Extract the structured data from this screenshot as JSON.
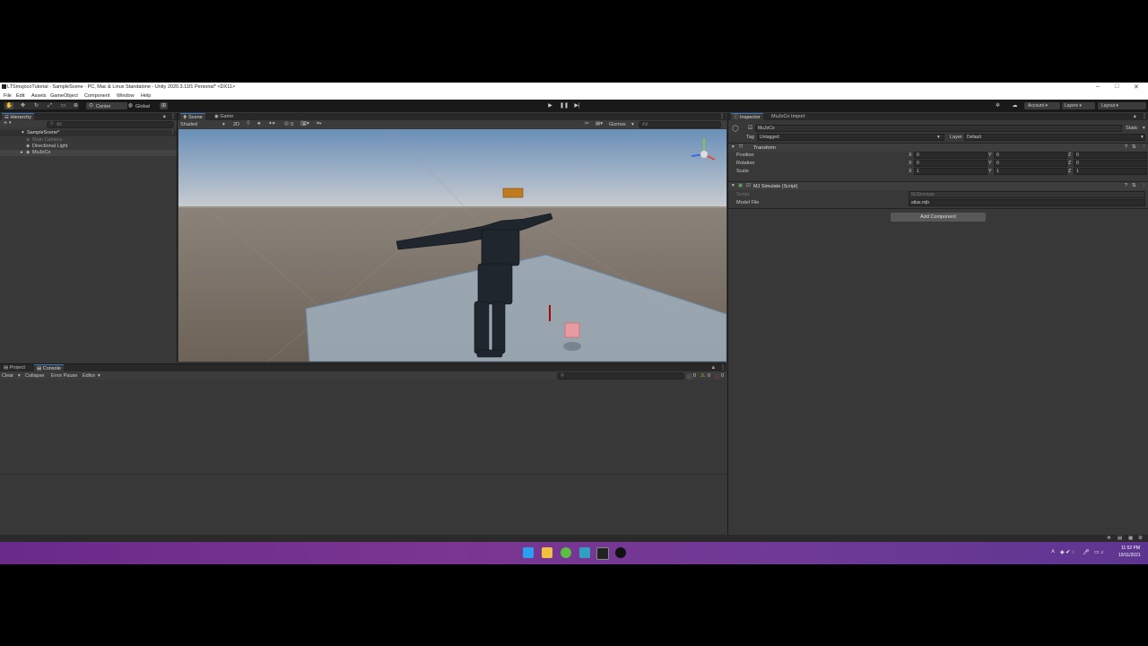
{
  "window": {
    "title": "LTSmujocoTutorial - SampleScene - PC, Mac & Linux Standalone - Unity 2020.3.11f1 Personal* <DX11>",
    "controls": {
      "minimize": "–",
      "maximize": "□",
      "close": "✕"
    }
  },
  "menu": [
    "File",
    "Edit",
    "Assets",
    "GameObject",
    "Component",
    "Window",
    "Help"
  ],
  "toolbar": {
    "pivot": "Center",
    "space": "Global",
    "account": "Account",
    "layers": "Layers",
    "layout": "Layout"
  },
  "hierarchy": {
    "tab": "Hierarchy",
    "add": "+",
    "search_placeholder": "All",
    "scene": "SampleScene*",
    "items": [
      "Main Camera",
      "Directional Light",
      "MuJoCo"
    ]
  },
  "scene_view": {
    "tabs": [
      "Scene",
      "Game"
    ],
    "shading": "Shaded",
    "mode_2d": "2D",
    "gizmos": "Gizmos",
    "search_placeholder": "All",
    "fx_count": "0"
  },
  "console": {
    "tabs": [
      "Project",
      "Console"
    ],
    "buttons": [
      "Clear",
      "Collapse",
      "Error Pause",
      "Editor"
    ],
    "counts": [
      "0",
      "0",
      "0"
    ]
  },
  "inspector": {
    "tabs": [
      "Inspector",
      "MuJoCo Import"
    ],
    "object_name": "MuJoCo",
    "static_label": "Static",
    "tag_label": "Tag",
    "tag_value": "Untagged",
    "layer_label": "Layer",
    "layer_value": "Default",
    "transform": {
      "title": "Transform",
      "rows": [
        {
          "label": "Position",
          "x": "0",
          "y": "0",
          "z": "0"
        },
        {
          "label": "Rotation",
          "x": "0",
          "y": "0",
          "z": "0"
        },
        {
          "label": "Scale",
          "x": "1",
          "y": "1",
          "z": "1"
        }
      ]
    },
    "script_component": {
      "title": "MJ Simulate (Script)",
      "script_label": "Script",
      "script_value": "MJSimulate",
      "model_label": "Model File",
      "model_value": "atlas.mjb"
    },
    "add_component": "Add Component"
  },
  "taskbar": {
    "time": "11:52 PM",
    "date": "10/11/2021"
  },
  "colors": {
    "accent": "#3a79bb",
    "taskbar": "#6a2a8a",
    "editor_bg": "#383838"
  }
}
